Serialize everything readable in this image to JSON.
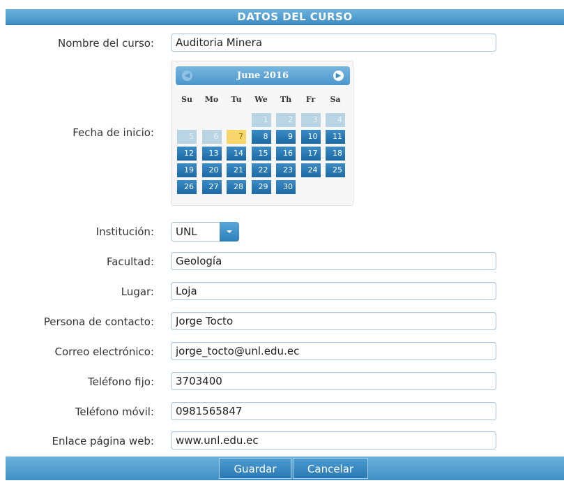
{
  "header": {
    "title": "DATOS DEL CURSO"
  },
  "form": {
    "nombre": {
      "label": "Nombre del curso:",
      "value": "Auditoria Minera"
    },
    "fecha": {
      "label": "Fecha de inicio:"
    },
    "institucion": {
      "label": "Institución:",
      "value": "UNL"
    },
    "facultad": {
      "label": "Facultad:",
      "value": "Geología"
    },
    "lugar": {
      "label": "Lugar:",
      "value": "Loja"
    },
    "contacto": {
      "label": "Persona de contacto:",
      "value": "Jorge Tocto"
    },
    "correo": {
      "label": "Correo electrónico:",
      "value": "jorge_tocto@unl.edu.ec"
    },
    "fijo": {
      "label": "Teléfono fijo:",
      "value": "3703400"
    },
    "movil": {
      "label": "Teléfono móvil:",
      "value": "0981565847"
    },
    "web": {
      "label": "Enlace página web:",
      "value": "www.unl.edu.ec"
    }
  },
  "calendar": {
    "title": "June 2016",
    "prev_icon": "circle-prev-icon",
    "next_icon": "circle-next-icon",
    "weekdays": [
      "Su",
      "Mo",
      "Tu",
      "We",
      "Th",
      "Fr",
      "Sa"
    ],
    "first_weekday": 3,
    "days_in_month": 30,
    "today": 7
  },
  "footer": {
    "save_label": "Guardar",
    "cancel_label": "Cancelar"
  },
  "colors": {
    "accent": "#3f8fc4",
    "today": "#f7d76b",
    "past_day": "#b9d4e3",
    "future_day": "#1d6aa5"
  }
}
